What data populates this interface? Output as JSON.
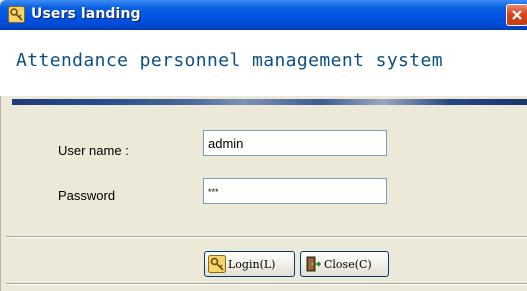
{
  "window": {
    "title": "Users landing",
    "icon": "key-icon",
    "close_icon": "close-icon"
  },
  "header": {
    "app_title": "Attendance personnel management system"
  },
  "form": {
    "username": {
      "label": "User name :",
      "value": "admin"
    },
    "password": {
      "label": "Password",
      "value": "***"
    }
  },
  "buttons": {
    "login": {
      "label": "Login(L)",
      "icon": "key-icon"
    },
    "close": {
      "label": "Close(C)",
      "icon": "exit-door-icon"
    }
  },
  "colors": {
    "titlebar": "#0055E5",
    "app_title": "#0b4f86",
    "dialog_bg": "#ECE9D8"
  }
}
